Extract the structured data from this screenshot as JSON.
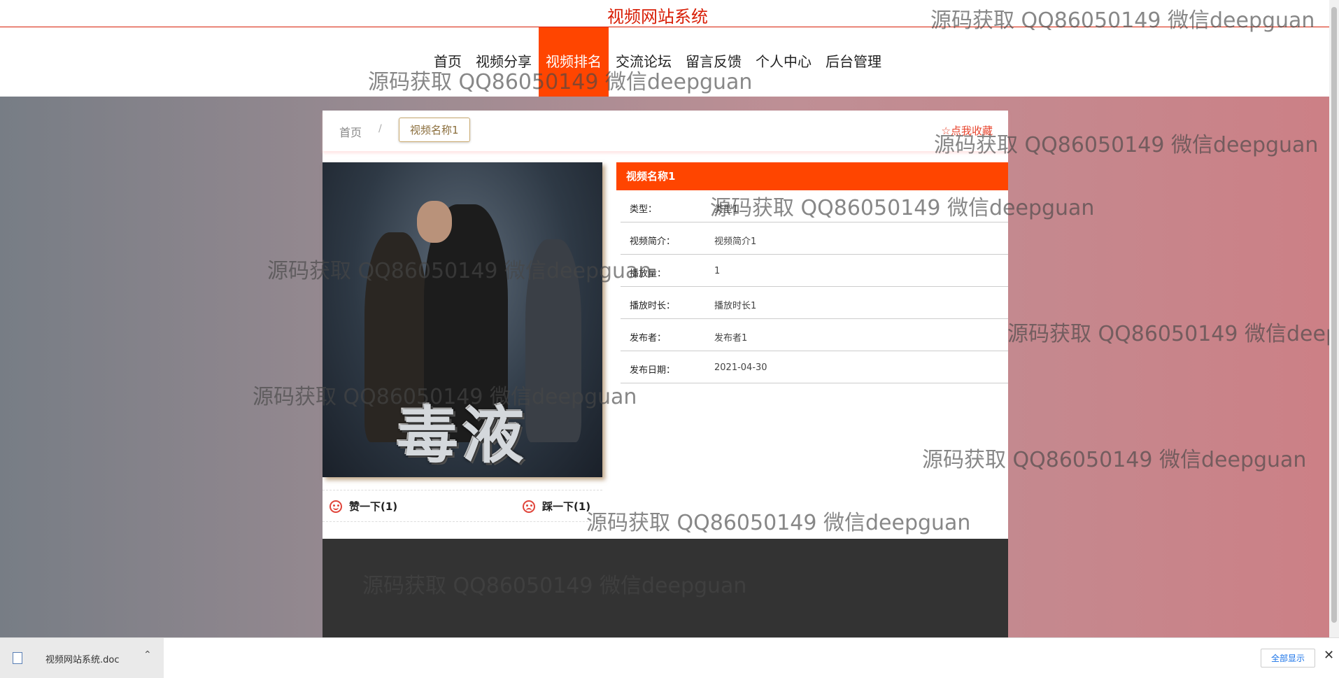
{
  "header": {
    "site_title": "视频网站系统",
    "nav": [
      "首页",
      "视频分享",
      "视频排名",
      "交流论坛",
      "留言反馈",
      "个人中心",
      "后台管理"
    ],
    "active_nav": "视频排名"
  },
  "breadcrumb": {
    "home": "首页",
    "separator": "/",
    "current": "视频名称1"
  },
  "favorite_label": "☆点我收藏",
  "poster_title": "毒液",
  "video": {
    "name": "视频名称1",
    "rows": [
      {
        "label": "类型：",
        "value": "类型1"
      },
      {
        "label": "视频简介：",
        "value": "视频简介1"
      },
      {
        "label": "播放量：",
        "value": "1"
      },
      {
        "label": "播放时长：",
        "value": "播放时长1"
      },
      {
        "label": "发布者：",
        "value": "发布者1"
      },
      {
        "label": "发布日期：",
        "value": "2021-04-30"
      }
    ]
  },
  "votes": {
    "like": "赞一下(1)",
    "dislike": "踩一下(1)"
  },
  "watermark_text": "源码获取 QQ86050149 微信deepguan",
  "download_bar": {
    "file_name": "视频网站系统.doc",
    "show_all": "全部显示",
    "close": "✕",
    "chevron": "⌃"
  },
  "colors": {
    "accent": "#ff4500",
    "title_red": "#d81e06",
    "footer": "#333333"
  }
}
